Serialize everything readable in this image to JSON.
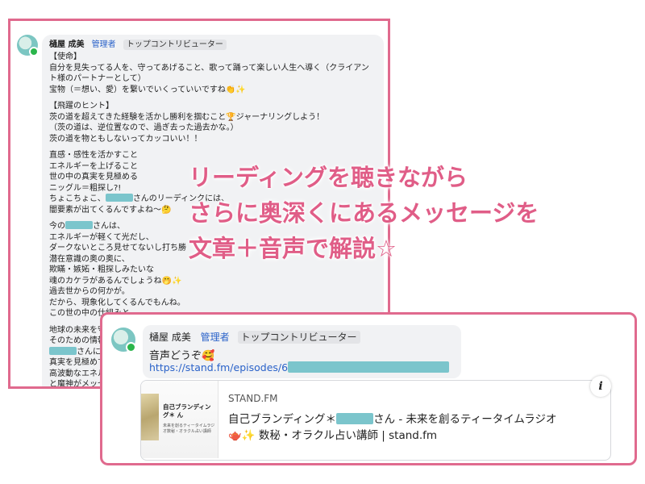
{
  "message1": {
    "name": "樋屋 成美",
    "role": "管理者",
    "badge": "トップコントリビューター",
    "paragraphs": [
      [
        "【使命】",
        "自分を見失ってる人を、守ってあげること、歌って踊って楽しい人生へ導く（クライアン",
        "ト様のパートナーとして）",
        "宝物（＝想い、愛）を繋いでいくっていいですね👏✨"
      ],
      [
        "【飛躍のヒント】",
        "茨の道を超えてきた経験を活かし勝利を掴むこと🏆ジャーナリングしよう！",
        "（茨の道は、逆位置なので、過ぎ去った過去かな。）",
        "茨の道を物ともしないってカッコいい！！"
      ]
    ],
    "line_a1": "直感・感性を活かすこと",
    "line_a2": "エネルギーを上げること",
    "line_a3": "世の中の真実を見極める",
    "line_a4": "ニッグル＝粗探し?!",
    "line_a5_pre": "ちょこちょこ、",
    "line_a5_post": "さんのリーディンクには、",
    "line_a6": "闇要素が出てくるんですよね〜🤔",
    "line_b1_pre": "今の",
    "line_b1_post": "さんは、",
    "line_b2": "エネルギーが軽くて光だし、",
    "line_b3": "ダークないところ見せてないし打ち勝",
    "line_b4": "潜在意識の奥の奥に、",
    "line_b5": "欺瞞・嫉妬・粗探しみたいな",
    "line_b6": "魂のカケラがあるんでしょうね🤭✨",
    "line_b7": "過去世からの何かが。",
    "line_b8": "だから、現象化してくるんでもんね。",
    "line_b9": "この世の中の仕組みと",
    "line_c1": "地球の未来を守",
    "line_c2": "そのための情報",
    "line_c3_post": "さんに許",
    "line_c4": "真実を見極めて",
    "line_c5": "高波動なエネル",
    "line_c6": "と魔神がメッセ"
  },
  "overlay": {
    "line1": "リーディングを聴きながら",
    "line2": "さらに奥深くにあるメッセージを",
    "line3": "文章＋音声で解説☆"
  },
  "message2": {
    "name": "樋屋 成美",
    "role": "管理者",
    "badge": "トップコントリビューター",
    "text": "音声どうぞ🥰",
    "link_prefix": "https://stand.fm/episodes/6",
    "card": {
      "site": "STAND.FM",
      "title_pre": "自己ブランディング＊",
      "title_post": "さん - 未来を創るティータイムラジオ",
      "title_line2": "🫖✨ 数秘・オラクル占い講師 | stand.fm",
      "thumb_title": "自己ブランディング＊ ん",
      "thumb_sub": "未来を創るティータイムラジオ数秘・オラクル占い講師"
    },
    "info_icon": "i"
  }
}
